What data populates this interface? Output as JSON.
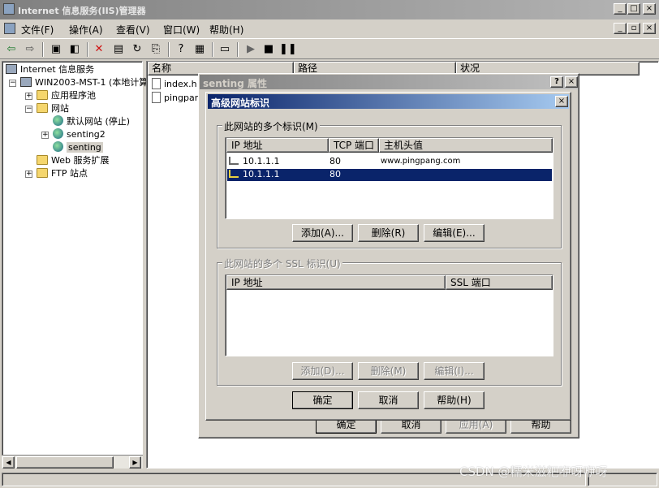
{
  "window": {
    "title": "Internet 信息服务(IIS)管理器"
  },
  "menu": [
    {
      "label": "文件(F)"
    },
    {
      "label": "操作(A)"
    },
    {
      "label": "查看(V)"
    },
    {
      "label": "窗口(W)"
    },
    {
      "label": "帮助(H)"
    }
  ],
  "caption_buttons": {
    "minimize": "_",
    "maximize": "□",
    "close": "×"
  },
  "mdi_buttons": {
    "minimize": "_",
    "restore": "▫",
    "close": "×"
  },
  "toolbar_icons": [
    "back-icon",
    "forward-icon",
    "up-icon",
    "show-hide-tree-icon",
    "delete-icon",
    "properties-icon",
    "refresh-icon",
    "export-icon",
    "help-icon",
    "view-icon",
    "computer-icon",
    "play-icon",
    "stop-icon",
    "pause-icon"
  ],
  "tree": {
    "root": "Internet 信息服务",
    "server": "WIN2003-MST-1 (本地计算",
    "app_pools": "应用程序池",
    "websites": "网站",
    "default_site": "默认网站 (停止)",
    "senting2": "senting2",
    "senting": "senting",
    "web_ext": "Web 服务扩展",
    "ftp": "FTP 站点"
  },
  "list": {
    "columns": [
      "名称",
      "路径",
      "状况"
    ],
    "files": [
      "index.h",
      "pingpan"
    ]
  },
  "prop_dialog": {
    "title": "senting 属性",
    "help_btn": "?",
    "close_btn": "×",
    "ok": "确定",
    "cancel": "取消",
    "apply": "应用(A)",
    "help": "帮助"
  },
  "adv_dialog": {
    "title": "高级网站标识",
    "close_btn": "×",
    "ident_group": "此网站的多个标识(M)",
    "ident_columns": [
      "IP 地址",
      "TCP 端口",
      "主机头值"
    ],
    "ident_rows": [
      {
        "ip": "10.1.1.1",
        "port": "80",
        "host": "www.pingpang.com",
        "selected": false
      },
      {
        "ip": "10.1.1.1",
        "port": "80",
        "host": "",
        "selected": true
      }
    ],
    "add": "添加(A)...",
    "remove": "删除(R)",
    "edit": "编辑(E)...",
    "ssl_group": "此网站的多个 SSL 标识(U)",
    "ssl_columns": [
      "IP 地址",
      "SSL 端口"
    ],
    "ssl_add": "添加(D)...",
    "ssl_remove": "删除(M)",
    "ssl_edit": "编辑(I)...",
    "ok": "确定",
    "cancel": "取消",
    "help": "帮助(H)"
  },
  "watermark": "CSDN @糯米滋粑咿呀咿呀",
  "colors": {
    "active_title": "#0a246a",
    "selection": "#0a246a",
    "face": "#d4d0c8"
  }
}
